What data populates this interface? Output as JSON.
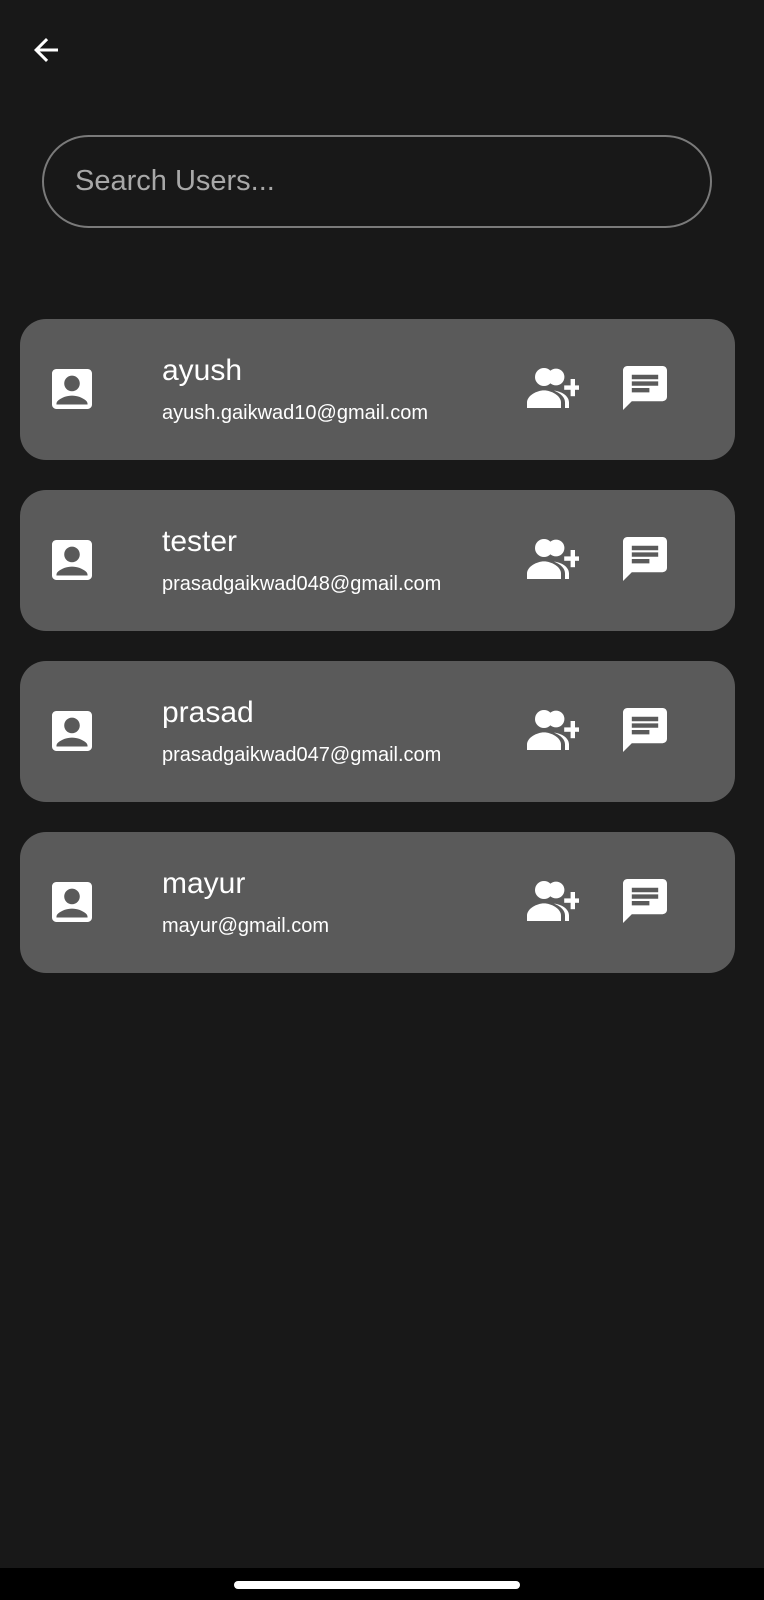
{
  "header": {
    "back_icon": "arrow-left-icon"
  },
  "search": {
    "placeholder": "Search Users...",
    "value": ""
  },
  "users": [
    {
      "name": "ayush",
      "email": "ayush.gaikwad10@gmail.com"
    },
    {
      "name": "tester",
      "email": "prasadgaikwad048@gmail.com"
    },
    {
      "name": "prasad",
      "email": "prasadgaikwad047@gmail.com"
    },
    {
      "name": "mayur",
      "email": "mayur@gmail.com"
    }
  ],
  "icons": {
    "contact": "contact-card-icon",
    "add_friend": "person-add-icon",
    "chat": "chat-bubble-icon"
  },
  "colors": {
    "background": "#181818",
    "card": "#5a5a5a",
    "search_border": "#7a7a7a",
    "placeholder": "#a8a8a8",
    "text": "#ffffff"
  }
}
